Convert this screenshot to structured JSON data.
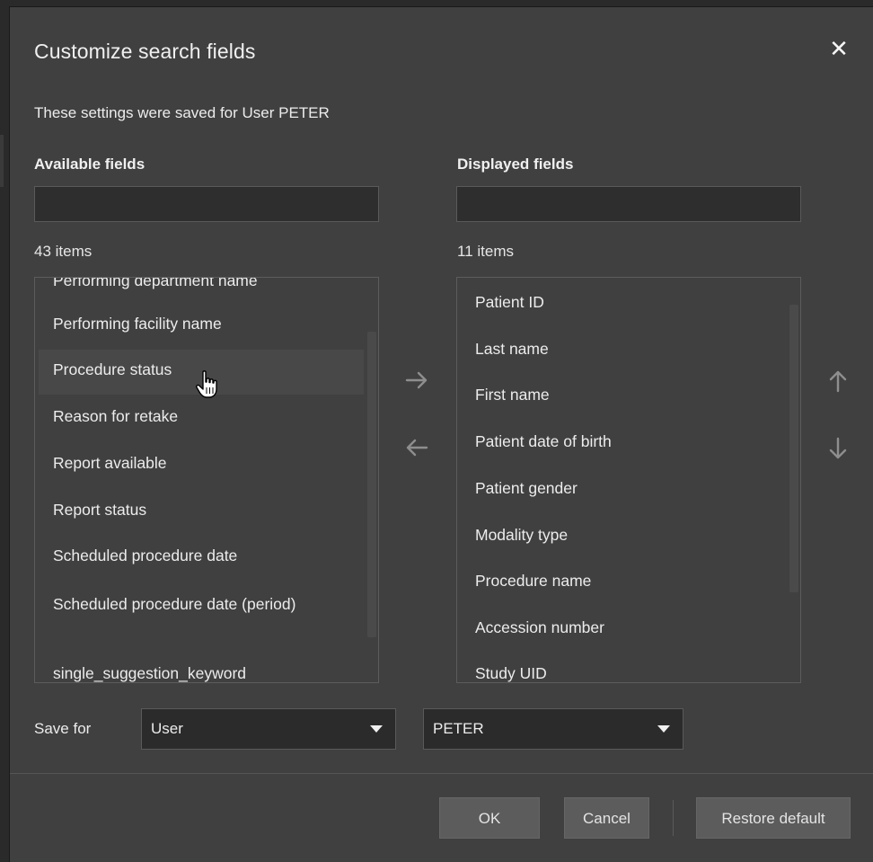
{
  "dialog": {
    "title": "Customize search fields",
    "close_icon": "close-icon",
    "subtitle": "These settings were saved for User PETER"
  },
  "available": {
    "label": "Available fields",
    "filter_value": "",
    "count": "43 items",
    "items": [
      "Performing department name",
      "Performing facility name",
      "Procedure status",
      "Reason for retake",
      "Report available",
      "Report status",
      "Scheduled procedure date",
      "Scheduled procedure date (period)",
      "single_suggestion_keyword"
    ],
    "hovered_item": "Procedure status"
  },
  "displayed": {
    "label": "Displayed fields",
    "filter_value": "",
    "count": "11 items",
    "items": [
      "Patient ID",
      "Last name",
      "First name",
      "Patient date of birth",
      "Patient gender",
      "Modality type",
      "Procedure name",
      "Accession number",
      "Study UID"
    ]
  },
  "transfer": {
    "add_icon": "arrow-right-icon",
    "remove_icon": "arrow-left-icon",
    "move_up_icon": "arrow-up-icon",
    "move_down_icon": "arrow-down-icon"
  },
  "save_for": {
    "label": "Save for",
    "scope_value": "User",
    "user_value": "PETER"
  },
  "buttons": {
    "ok": "OK",
    "cancel": "Cancel",
    "restore": "Restore default"
  },
  "colors": {
    "dialog_bg": "#404040",
    "input_bg": "#2e2e2e",
    "button_bg": "#5c5c5c",
    "arrow_color": "#8e8e8e"
  }
}
